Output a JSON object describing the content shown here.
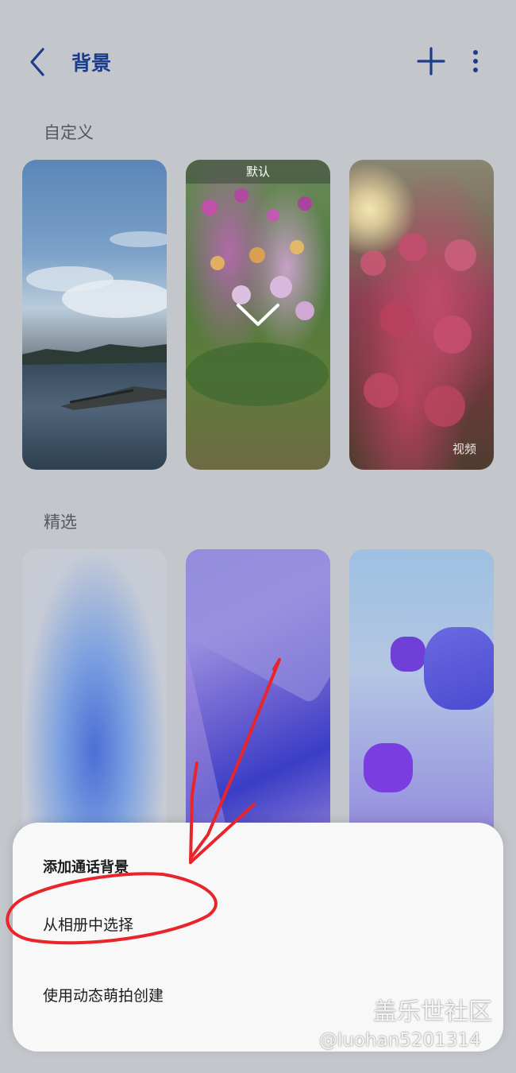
{
  "header": {
    "title": "背景",
    "back_icon": "chevron-left-icon",
    "add_icon": "plus-icon",
    "more_icon": "more-vertical-icon",
    "accent_color": "#1c3d8c"
  },
  "sections": {
    "custom_label": "自定义",
    "featured_label": "精选"
  },
  "custom_items": [
    {
      "name": "lake-wallpaper"
    },
    {
      "name": "flower-wallpaper",
      "badge": "默认",
      "selected": true
    },
    {
      "name": "peach-blossom-wallpaper",
      "tag": "视频"
    }
  ],
  "featured_items": [
    {
      "name": "blue-gradient-wallpaper"
    },
    {
      "name": "purple-gradient-wallpaper"
    },
    {
      "name": "purple-blobs-wallpaper"
    }
  ],
  "sheet": {
    "title": "添加通话背景",
    "options": [
      "从相册中选择",
      "使用动态萌拍创建"
    ]
  },
  "watermark": {
    "brand": "盖乐世社区",
    "user": "@luohan5201314"
  },
  "annotation_color": "#e8252b"
}
